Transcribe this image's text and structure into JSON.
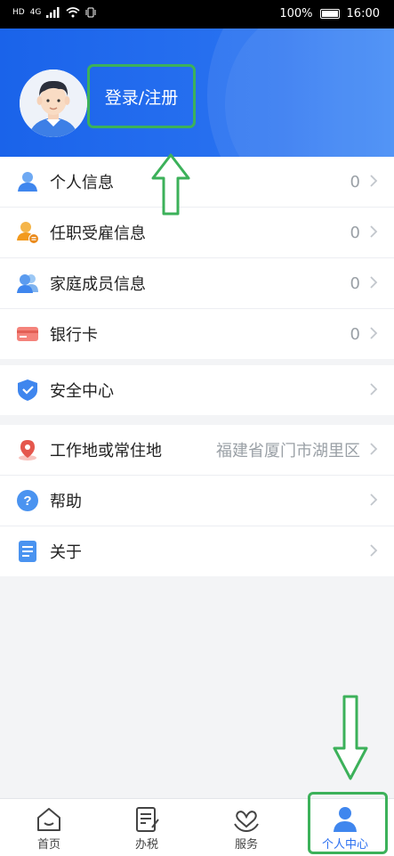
{
  "status_bar": {
    "left_indicators": [
      "HD",
      "4G"
    ],
    "battery": "100%",
    "time": "16:00"
  },
  "header": {
    "login_label": "登录/注册"
  },
  "group1": [
    {
      "label": "个人信息",
      "value": "0",
      "icon": "person-icon"
    },
    {
      "label": "任职受雇信息",
      "value": "0",
      "icon": "employment-icon"
    },
    {
      "label": "家庭成员信息",
      "value": "0",
      "icon": "family-icon"
    },
    {
      "label": "银行卡",
      "value": "0",
      "icon": "bank-card-icon"
    }
  ],
  "group2": [
    {
      "label": "安全中心",
      "icon": "shield-icon"
    }
  ],
  "group3": [
    {
      "label": "工作地或常住地",
      "value": "福建省厦门市湖里区",
      "icon": "location-pin-icon"
    },
    {
      "label": "帮助",
      "icon": "help-icon"
    },
    {
      "label": "关于",
      "icon": "document-icon"
    }
  ],
  "bottom_nav": [
    {
      "label": "首页",
      "icon": "home-icon"
    },
    {
      "label": "办税",
      "icon": "tax-icon"
    },
    {
      "label": "服务",
      "icon": "service-icon"
    },
    {
      "label": "个人中心",
      "icon": "profile-icon",
      "active": true
    }
  ],
  "colors": {
    "header_blue": "#1a63ea",
    "highlight_green": "#3cb15a",
    "active_blue": "#2a6ff0"
  }
}
